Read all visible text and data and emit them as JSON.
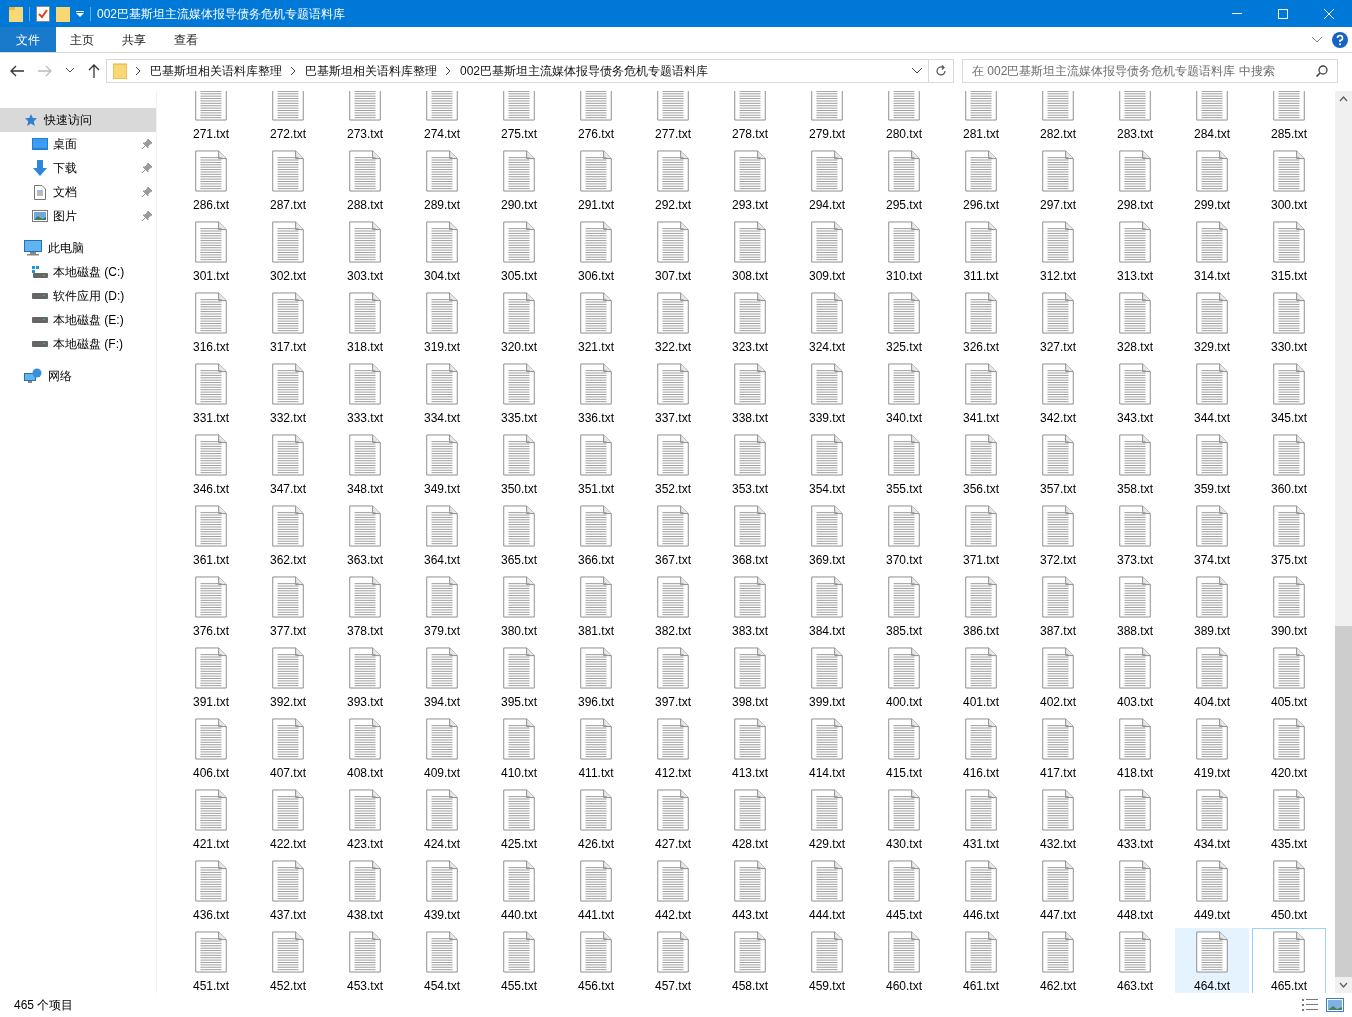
{
  "window": {
    "title": "002巴基斯坦主流媒体报导债务危机专题语料库"
  },
  "ribbon": {
    "tabs": [
      {
        "label": "文件",
        "kind": "menu",
        "selected": false
      },
      {
        "label": "主页",
        "kind": "tab",
        "selected": false
      },
      {
        "label": "共享",
        "kind": "tab",
        "selected": false
      },
      {
        "label": "查看",
        "kind": "tab",
        "selected": false
      }
    ]
  },
  "address_bar": {
    "segments": [
      "巴基斯坦相关语料库整理",
      "巴基斯坦相关语料库整理",
      "002巴基斯坦主流媒体报导债务危机专题语料库"
    ]
  },
  "search": {
    "placeholder": "在 002巴基斯坦主流媒体报导债务危机专题语料库 中搜索"
  },
  "sidebar": {
    "items": [
      {
        "label": "快速访问",
        "kind": "star",
        "selected": true,
        "children": [
          {
            "label": "桌面",
            "kind": "desktop",
            "pinned": true,
            "selected": false
          },
          {
            "label": "下载",
            "kind": "download",
            "pinned": true,
            "selected": false
          },
          {
            "label": "文档",
            "kind": "document",
            "pinned": true,
            "selected": false
          },
          {
            "label": "图片",
            "kind": "picture",
            "pinned": true,
            "selected": false
          }
        ]
      },
      {
        "label": "此电脑",
        "kind": "computer",
        "selected": false,
        "children": [
          {
            "label": "本地磁盘 (C:)",
            "kind": "system_drive",
            "pinned": false,
            "selected": false
          },
          {
            "label": "软件应用 (D:)",
            "kind": "drive",
            "pinned": false,
            "selected": false
          },
          {
            "label": "本地磁盘 (E:)",
            "kind": "drive",
            "pinned": false,
            "selected": false
          },
          {
            "label": "本地磁盘 (F:)",
            "kind": "drive",
            "pinned": false,
            "selected": false
          }
        ]
      },
      {
        "label": "网络",
        "kind": "network",
        "selected": false
      }
    ]
  },
  "files": [
    {
      "name": "271.txt",
      "hovered": false,
      "focused": false
    },
    {
      "name": "272.txt",
      "hovered": false,
      "focused": false
    },
    {
      "name": "273.txt",
      "hovered": false,
      "focused": false
    },
    {
      "name": "274.txt",
      "hovered": false,
      "focused": false
    },
    {
      "name": "275.txt",
      "hovered": false,
      "focused": false
    },
    {
      "name": "276.txt",
      "hovered": false,
      "focused": false
    },
    {
      "name": "277.txt",
      "hovered": false,
      "focused": false
    },
    {
      "name": "278.txt",
      "hovered": false,
      "focused": false
    },
    {
      "name": "279.txt",
      "hovered": false,
      "focused": false
    },
    {
      "name": "280.txt",
      "hovered": false,
      "focused": false
    },
    {
      "name": "281.txt",
      "hovered": false,
      "focused": false
    },
    {
      "name": "282.txt",
      "hovered": false,
      "focused": false
    },
    {
      "name": "283.txt",
      "hovered": false,
      "focused": false
    },
    {
      "name": "284.txt",
      "hovered": false,
      "focused": false
    },
    {
      "name": "285.txt",
      "hovered": false,
      "focused": false
    },
    {
      "name": "286.txt",
      "hovered": false,
      "focused": false
    },
    {
      "name": "287.txt",
      "hovered": false,
      "focused": false
    },
    {
      "name": "288.txt",
      "hovered": false,
      "focused": false
    },
    {
      "name": "289.txt",
      "hovered": false,
      "focused": false
    },
    {
      "name": "290.txt",
      "hovered": false,
      "focused": false
    },
    {
      "name": "291.txt",
      "hovered": false,
      "focused": false
    },
    {
      "name": "292.txt",
      "hovered": false,
      "focused": false
    },
    {
      "name": "293.txt",
      "hovered": false,
      "focused": false
    },
    {
      "name": "294.txt",
      "hovered": false,
      "focused": false
    },
    {
      "name": "295.txt",
      "hovered": false,
      "focused": false
    },
    {
      "name": "296.txt",
      "hovered": false,
      "focused": false
    },
    {
      "name": "297.txt",
      "hovered": false,
      "focused": false
    },
    {
      "name": "298.txt",
      "hovered": false,
      "focused": false
    },
    {
      "name": "299.txt",
      "hovered": false,
      "focused": false
    },
    {
      "name": "300.txt",
      "hovered": false,
      "focused": false
    },
    {
      "name": "301.txt",
      "hovered": false,
      "focused": false
    },
    {
      "name": "302.txt",
      "hovered": false,
      "focused": false
    },
    {
      "name": "303.txt",
      "hovered": false,
      "focused": false
    },
    {
      "name": "304.txt",
      "hovered": false,
      "focused": false
    },
    {
      "name": "305.txt",
      "hovered": false,
      "focused": false
    },
    {
      "name": "306.txt",
      "hovered": false,
      "focused": false
    },
    {
      "name": "307.txt",
      "hovered": false,
      "focused": false
    },
    {
      "name": "308.txt",
      "hovered": false,
      "focused": false
    },
    {
      "name": "309.txt",
      "hovered": false,
      "focused": false
    },
    {
      "name": "310.txt",
      "hovered": false,
      "focused": false
    },
    {
      "name": "311.txt",
      "hovered": false,
      "focused": false
    },
    {
      "name": "312.txt",
      "hovered": false,
      "focused": false
    },
    {
      "name": "313.txt",
      "hovered": false,
      "focused": false
    },
    {
      "name": "314.txt",
      "hovered": false,
      "focused": false
    },
    {
      "name": "315.txt",
      "hovered": false,
      "focused": false
    },
    {
      "name": "316.txt",
      "hovered": false,
      "focused": false
    },
    {
      "name": "317.txt",
      "hovered": false,
      "focused": false
    },
    {
      "name": "318.txt",
      "hovered": false,
      "focused": false
    },
    {
      "name": "319.txt",
      "hovered": false,
      "focused": false
    },
    {
      "name": "320.txt",
      "hovered": false,
      "focused": false
    },
    {
      "name": "321.txt",
      "hovered": false,
      "focused": false
    },
    {
      "name": "322.txt",
      "hovered": false,
      "focused": false
    },
    {
      "name": "323.txt",
      "hovered": false,
      "focused": false
    },
    {
      "name": "324.txt",
      "hovered": false,
      "focused": false
    },
    {
      "name": "325.txt",
      "hovered": false,
      "focused": false
    },
    {
      "name": "326.txt",
      "hovered": false,
      "focused": false
    },
    {
      "name": "327.txt",
      "hovered": false,
      "focused": false
    },
    {
      "name": "328.txt",
      "hovered": false,
      "focused": false
    },
    {
      "name": "329.txt",
      "hovered": false,
      "focused": false
    },
    {
      "name": "330.txt",
      "hovered": false,
      "focused": false
    },
    {
      "name": "331.txt",
      "hovered": false,
      "focused": false
    },
    {
      "name": "332.txt",
      "hovered": false,
      "focused": false
    },
    {
      "name": "333.txt",
      "hovered": false,
      "focused": false
    },
    {
      "name": "334.txt",
      "hovered": false,
      "focused": false
    },
    {
      "name": "335.txt",
      "hovered": false,
      "focused": false
    },
    {
      "name": "336.txt",
      "hovered": false,
      "focused": false
    },
    {
      "name": "337.txt",
      "hovered": false,
      "focused": false
    },
    {
      "name": "338.txt",
      "hovered": false,
      "focused": false
    },
    {
      "name": "339.txt",
      "hovered": false,
      "focused": false
    },
    {
      "name": "340.txt",
      "hovered": false,
      "focused": false
    },
    {
      "name": "341.txt",
      "hovered": false,
      "focused": false
    },
    {
      "name": "342.txt",
      "hovered": false,
      "focused": false
    },
    {
      "name": "343.txt",
      "hovered": false,
      "focused": false
    },
    {
      "name": "344.txt",
      "hovered": false,
      "focused": false
    },
    {
      "name": "345.txt",
      "hovered": false,
      "focused": false
    },
    {
      "name": "346.txt",
      "hovered": false,
      "focused": false
    },
    {
      "name": "347.txt",
      "hovered": false,
      "focused": false
    },
    {
      "name": "348.txt",
      "hovered": false,
      "focused": false
    },
    {
      "name": "349.txt",
      "hovered": false,
      "focused": false
    },
    {
      "name": "350.txt",
      "hovered": false,
      "focused": false
    },
    {
      "name": "351.txt",
      "hovered": false,
      "focused": false
    },
    {
      "name": "352.txt",
      "hovered": false,
      "focused": false
    },
    {
      "name": "353.txt",
      "hovered": false,
      "focused": false
    },
    {
      "name": "354.txt",
      "hovered": false,
      "focused": false
    },
    {
      "name": "355.txt",
      "hovered": false,
      "focused": false
    },
    {
      "name": "356.txt",
      "hovered": false,
      "focused": false
    },
    {
      "name": "357.txt",
      "hovered": false,
      "focused": false
    },
    {
      "name": "358.txt",
      "hovered": false,
      "focused": false
    },
    {
      "name": "359.txt",
      "hovered": false,
      "focused": false
    },
    {
      "name": "360.txt",
      "hovered": false,
      "focused": false
    },
    {
      "name": "361.txt",
      "hovered": false,
      "focused": false
    },
    {
      "name": "362.txt",
      "hovered": false,
      "focused": false
    },
    {
      "name": "363.txt",
      "hovered": false,
      "focused": false
    },
    {
      "name": "364.txt",
      "hovered": false,
      "focused": false
    },
    {
      "name": "365.txt",
      "hovered": false,
      "focused": false
    },
    {
      "name": "366.txt",
      "hovered": false,
      "focused": false
    },
    {
      "name": "367.txt",
      "hovered": false,
      "focused": false
    },
    {
      "name": "368.txt",
      "hovered": false,
      "focused": false
    },
    {
      "name": "369.txt",
      "hovered": false,
      "focused": false
    },
    {
      "name": "370.txt",
      "hovered": false,
      "focused": false
    },
    {
      "name": "371.txt",
      "hovered": false,
      "focused": false
    },
    {
      "name": "372.txt",
      "hovered": false,
      "focused": false
    },
    {
      "name": "373.txt",
      "hovered": false,
      "focused": false
    },
    {
      "name": "374.txt",
      "hovered": false,
      "focused": false
    },
    {
      "name": "375.txt",
      "hovered": false,
      "focused": false
    },
    {
      "name": "376.txt",
      "hovered": false,
      "focused": false
    },
    {
      "name": "377.txt",
      "hovered": false,
      "focused": false
    },
    {
      "name": "378.txt",
      "hovered": false,
      "focused": false
    },
    {
      "name": "379.txt",
      "hovered": false,
      "focused": false
    },
    {
      "name": "380.txt",
      "hovered": false,
      "focused": false
    },
    {
      "name": "381.txt",
      "hovered": false,
      "focused": false
    },
    {
      "name": "382.txt",
      "hovered": false,
      "focused": false
    },
    {
      "name": "383.txt",
      "hovered": false,
      "focused": false
    },
    {
      "name": "384.txt",
      "hovered": false,
      "focused": false
    },
    {
      "name": "385.txt",
      "hovered": false,
      "focused": false
    },
    {
      "name": "386.txt",
      "hovered": false,
      "focused": false
    },
    {
      "name": "387.txt",
      "hovered": false,
      "focused": false
    },
    {
      "name": "388.txt",
      "hovered": false,
      "focused": false
    },
    {
      "name": "389.txt",
      "hovered": false,
      "focused": false
    },
    {
      "name": "390.txt",
      "hovered": false,
      "focused": false
    },
    {
      "name": "391.txt",
      "hovered": false,
      "focused": false
    },
    {
      "name": "392.txt",
      "hovered": false,
      "focused": false
    },
    {
      "name": "393.txt",
      "hovered": false,
      "focused": false
    },
    {
      "name": "394.txt",
      "hovered": false,
      "focused": false
    },
    {
      "name": "395.txt",
      "hovered": false,
      "focused": false
    },
    {
      "name": "396.txt",
      "hovered": false,
      "focused": false
    },
    {
      "name": "397.txt",
      "hovered": false,
      "focused": false
    },
    {
      "name": "398.txt",
      "hovered": false,
      "focused": false
    },
    {
      "name": "399.txt",
      "hovered": false,
      "focused": false
    },
    {
      "name": "400.txt",
      "hovered": false,
      "focused": false
    },
    {
      "name": "401.txt",
      "hovered": false,
      "focused": false
    },
    {
      "name": "402.txt",
      "hovered": false,
      "focused": false
    },
    {
      "name": "403.txt",
      "hovered": false,
      "focused": false
    },
    {
      "name": "404.txt",
      "hovered": false,
      "focused": false
    },
    {
      "name": "405.txt",
      "hovered": false,
      "focused": false
    },
    {
      "name": "406.txt",
      "hovered": false,
      "focused": false
    },
    {
      "name": "407.txt",
      "hovered": false,
      "focused": false
    },
    {
      "name": "408.txt",
      "hovered": false,
      "focused": false
    },
    {
      "name": "409.txt",
      "hovered": false,
      "focused": false
    },
    {
      "name": "410.txt",
      "hovered": false,
      "focused": false
    },
    {
      "name": "411.txt",
      "hovered": false,
      "focused": false
    },
    {
      "name": "412.txt",
      "hovered": false,
      "focused": false
    },
    {
      "name": "413.txt",
      "hovered": false,
      "focused": false
    },
    {
      "name": "414.txt",
      "hovered": false,
      "focused": false
    },
    {
      "name": "415.txt",
      "hovered": false,
      "focused": false
    },
    {
      "name": "416.txt",
      "hovered": false,
      "focused": false
    },
    {
      "name": "417.txt",
      "hovered": false,
      "focused": false
    },
    {
      "name": "418.txt",
      "hovered": false,
      "focused": false
    },
    {
      "name": "419.txt",
      "hovered": false,
      "focused": false
    },
    {
      "name": "420.txt",
      "hovered": false,
      "focused": false
    },
    {
      "name": "421.txt",
      "hovered": false,
      "focused": false
    },
    {
      "name": "422.txt",
      "hovered": false,
      "focused": false
    },
    {
      "name": "423.txt",
      "hovered": false,
      "focused": false
    },
    {
      "name": "424.txt",
      "hovered": false,
      "focused": false
    },
    {
      "name": "425.txt",
      "hovered": false,
      "focused": false
    },
    {
      "name": "426.txt",
      "hovered": false,
      "focused": false
    },
    {
      "name": "427.txt",
      "hovered": false,
      "focused": false
    },
    {
      "name": "428.txt",
      "hovered": false,
      "focused": false
    },
    {
      "name": "429.txt",
      "hovered": false,
      "focused": false
    },
    {
      "name": "430.txt",
      "hovered": false,
      "focused": false
    },
    {
      "name": "431.txt",
      "hovered": false,
      "focused": false
    },
    {
      "name": "432.txt",
      "hovered": false,
      "focused": false
    },
    {
      "name": "433.txt",
      "hovered": false,
      "focused": false
    },
    {
      "name": "434.txt",
      "hovered": false,
      "focused": false
    },
    {
      "name": "435.txt",
      "hovered": false,
      "focused": false
    },
    {
      "name": "436.txt",
      "hovered": false,
      "focused": false
    },
    {
      "name": "437.txt",
      "hovered": false,
      "focused": false
    },
    {
      "name": "438.txt",
      "hovered": false,
      "focused": false
    },
    {
      "name": "439.txt",
      "hovered": false,
      "focused": false
    },
    {
      "name": "440.txt",
      "hovered": false,
      "focused": false
    },
    {
      "name": "441.txt",
      "hovered": false,
      "focused": false
    },
    {
      "name": "442.txt",
      "hovered": false,
      "focused": false
    },
    {
      "name": "443.txt",
      "hovered": false,
      "focused": false
    },
    {
      "name": "444.txt",
      "hovered": false,
      "focused": false
    },
    {
      "name": "445.txt",
      "hovered": false,
      "focused": false
    },
    {
      "name": "446.txt",
      "hovered": false,
      "focused": false
    },
    {
      "name": "447.txt",
      "hovered": false,
      "focused": false
    },
    {
      "name": "448.txt",
      "hovered": false,
      "focused": false
    },
    {
      "name": "449.txt",
      "hovered": false,
      "focused": false
    },
    {
      "name": "450.txt",
      "hovered": false,
      "focused": false
    },
    {
      "name": "451.txt",
      "hovered": false,
      "focused": false
    },
    {
      "name": "452.txt",
      "hovered": false,
      "focused": false
    },
    {
      "name": "453.txt",
      "hovered": false,
      "focused": false
    },
    {
      "name": "454.txt",
      "hovered": false,
      "focused": false
    },
    {
      "name": "455.txt",
      "hovered": false,
      "focused": false
    },
    {
      "name": "456.txt",
      "hovered": false,
      "focused": false
    },
    {
      "name": "457.txt",
      "hovered": false,
      "focused": false
    },
    {
      "name": "458.txt",
      "hovered": false,
      "focused": false
    },
    {
      "name": "459.txt",
      "hovered": false,
      "focused": false
    },
    {
      "name": "460.txt",
      "hovered": false,
      "focused": false
    },
    {
      "name": "461.txt",
      "hovered": false,
      "focused": false
    },
    {
      "name": "462.txt",
      "hovered": false,
      "focused": false
    },
    {
      "name": "463.txt",
      "hovered": false,
      "focused": false
    },
    {
      "name": "464.txt",
      "hovered": true,
      "focused": false
    },
    {
      "name": "465.txt",
      "hovered": false,
      "focused": true
    }
  ],
  "status_bar": {
    "item_count": "465 个项目"
  }
}
